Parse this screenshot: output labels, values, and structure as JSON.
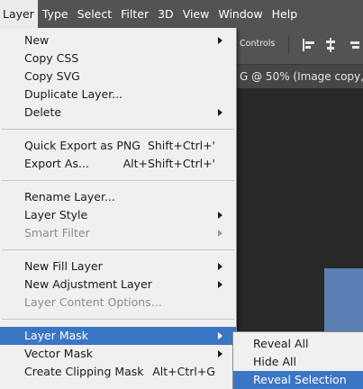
{
  "menubar": {
    "items": [
      "Layer",
      "Type",
      "Select",
      "Filter",
      "3D",
      "View",
      "Window",
      "Help"
    ]
  },
  "options_bar": {
    "controls_label": "Controls"
  },
  "document_tab": {
    "title": "G @ 50% (Image copy,"
  },
  "layer_menu": {
    "groups": [
      [
        {
          "label": "New",
          "submenu": true
        },
        {
          "label": "Copy CSS"
        },
        {
          "label": "Copy SVG"
        },
        {
          "label": "Duplicate Layer..."
        },
        {
          "label": "Delete",
          "submenu": true
        }
      ],
      [
        {
          "label": "Quick Export as PNG",
          "shortcut": "Shift+Ctrl+'"
        },
        {
          "label": "Export As...",
          "shortcut": "Alt+Shift+Ctrl+'"
        }
      ],
      [
        {
          "label": "Rename Layer..."
        },
        {
          "label": "Layer Style",
          "submenu": true
        },
        {
          "label": "Smart Filter",
          "submenu": true,
          "disabled": true
        }
      ],
      [
        {
          "label": "New Fill Layer",
          "submenu": true
        },
        {
          "label": "New Adjustment Layer",
          "submenu": true
        },
        {
          "label": "Layer Content Options...",
          "disabled": true
        }
      ],
      [
        {
          "label": "Layer Mask",
          "submenu": true,
          "highlighted": true
        },
        {
          "label": "Vector Mask",
          "submenu": true
        },
        {
          "label": "Create Clipping Mask",
          "shortcut": "Alt+Ctrl+G"
        }
      ]
    ]
  },
  "layer_mask_submenu": {
    "items": [
      {
        "label": "Reveal All"
      },
      {
        "label": "Hide All"
      },
      {
        "label": "Reveal Selection",
        "highlighted": true
      }
    ]
  },
  "colors": {
    "menu_highlight": "#3b76c4",
    "menu_background": "#f0f0f0",
    "menubar_background": "#535353",
    "canvas_image": "#5c7fb3"
  }
}
